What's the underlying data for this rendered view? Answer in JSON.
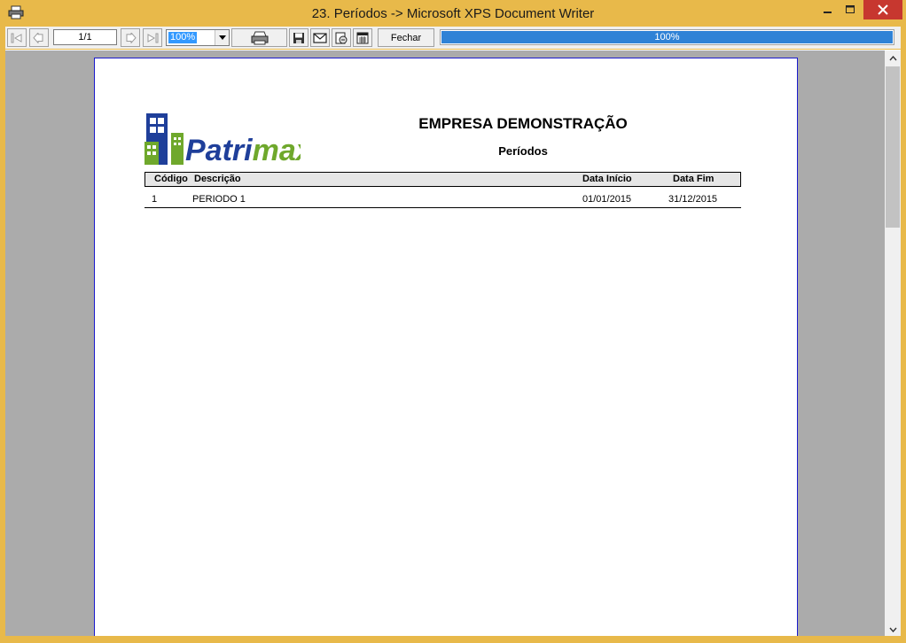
{
  "window": {
    "title": "23. Períodos -> Microsoft XPS Document Writer"
  },
  "toolbar": {
    "page_indicator": "1/1",
    "zoom": "100%",
    "close_label": "Fechar",
    "progress_label": "100%",
    "progress_fraction": 1.0
  },
  "report": {
    "company": "EMPRESA DEMONSTRAÇÃO",
    "title": "Períodos",
    "logo_text_a": "Patri",
    "logo_text_b": "max",
    "columns": {
      "code": "Código",
      "description": "Descrição",
      "start": "Data Início",
      "end": "Data Fim"
    },
    "rows": [
      {
        "code": "1",
        "description": "PERIODO 1",
        "start": "01/01/2015",
        "end": "31/12/2015"
      }
    ]
  },
  "colors": {
    "frame": "#e8b94a",
    "close": "#c7372f",
    "progress": "#2f82d6",
    "logo_blue": "#1f3f9a",
    "logo_green": "#6fa82c"
  },
  "icons": {
    "app": "printer-icon",
    "first_page": "first-page-icon",
    "prev_page": "prev-page-icon",
    "next_page": "next-page-icon",
    "last_page": "last-page-icon",
    "print": "print-icon",
    "save": "save-icon",
    "email": "email-icon",
    "export": "export-icon",
    "setup": "page-setup-icon"
  }
}
